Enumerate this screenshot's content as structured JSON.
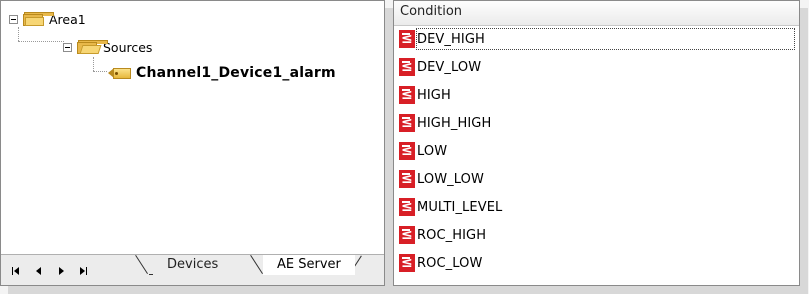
{
  "tree": {
    "area": "Area1",
    "sources": "Sources",
    "alarm": "Channel1_Device1_alarm"
  },
  "tabs": {
    "devices": "Devices",
    "ae_server": "AE Server"
  },
  "conditions": {
    "header": "Condition",
    "items": [
      "DEV_HIGH",
      "DEV_LOW",
      "HIGH",
      "HIGH_HIGH",
      "LOW",
      "LOW_LOW",
      "MULTI_LEVEL",
      "ROC_HIGH",
      "ROC_LOW"
    ],
    "selected": "DEV_HIGH"
  },
  "colors": {
    "condition_icon": "#d81f26",
    "folder": "#f7d675"
  },
  "icons": {
    "area": "folder-icon",
    "sources": "folder-open-icon",
    "alarm": "tag-icon",
    "condition": "less-equal-icon"
  }
}
